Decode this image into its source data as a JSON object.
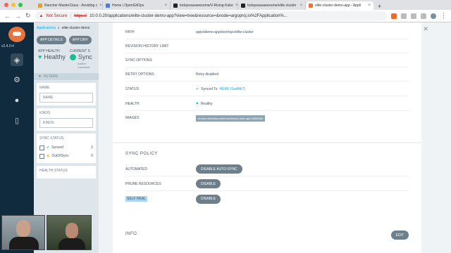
{
  "browser": {
    "tabs": [
      {
        "title": "Rancher MasterClass - Avoiding c",
        "color": "#e0a030",
        "active": false
      },
      {
        "title": "Home | OpenGitOps",
        "color": "#4a7fd4",
        "active": false
      },
      {
        "title": "todaywasawesome/V-Rising-Kube",
        "color": "#222222",
        "active": false
      },
      {
        "title": "todaywasawesome/elite-cluster",
        "color": "#222222",
        "active": false
      },
      {
        "title": "elite-cluster-demo-app - Appli",
        "color": "#e8743b",
        "active": true
      }
    ],
    "new_tab": "+",
    "not_secure": "Not Secure",
    "url_scheme": "https://",
    "url_rest": "10.0.0.20/applications/elite-cluster-demo-app?view=tree&resource=&node=argoproj.io%2FApplication%..."
  },
  "rail": {
    "version": "v2.4.0+f",
    "icons": [
      "layers-icon",
      "gear-icon",
      "user-icon",
      "docs-icon"
    ]
  },
  "sidebar": {
    "breadcrumb_root": "Applications",
    "breadcrumb_current": "elite-cluster-demo",
    "buttons": [
      "APP DETAILS",
      "APP DIFF"
    ],
    "app_health_label": "APP HEALTH",
    "app_health_value": "Healthy",
    "current_sync_label": "CURRENT S",
    "current_sync_value": "Sync",
    "sync_sub": "Author: Comment",
    "filters_label": "FILTERS",
    "name_label": "NAME",
    "name_placeholder": "NAME",
    "kinds_label": "KINDS",
    "kinds_placeholder": "KINDS",
    "sync_status_label": "SYNC STATUS",
    "sync_items": [
      {
        "label": "Synced",
        "count": "2"
      },
      {
        "label": "OutOfSync",
        "count": "0"
      }
    ],
    "health_status_label": "HEALTH STATUS"
  },
  "summary": {
    "rows": [
      {
        "key": "PATH",
        "value": "apps/demo-app/overlays/elite-cluster"
      },
      {
        "key": "REVISION HISTORY LIMIT",
        "value": ""
      },
      {
        "key": "SYNC OPTIONS",
        "value": ""
      },
      {
        "key": "RETRY OPTIONS",
        "value": "Retry disabled"
      },
      {
        "key": "STATUS",
        "value_prefix": "Synced To",
        "value_link": "HEAD (6adf4b7)"
      },
      {
        "key": "HEALTH",
        "value": "Healthy"
      },
      {
        "key": "IMAGES",
        "value": "docker.io/kostiscodefresh/simple-web-app:3d9b5f83"
      }
    ]
  },
  "sync_policy": {
    "title": "SYNC POLICY",
    "rows": [
      {
        "key": "AUTOMATED",
        "button": "DISABLE AUTO-SYNC"
      },
      {
        "key": "PRUNE RESOURCES",
        "button": "DISABLE"
      },
      {
        "key": "SELF HEAL",
        "button": "DISABLE"
      }
    ]
  },
  "info": {
    "title": "INFO",
    "edit": "EDIT"
  },
  "close": "✕"
}
